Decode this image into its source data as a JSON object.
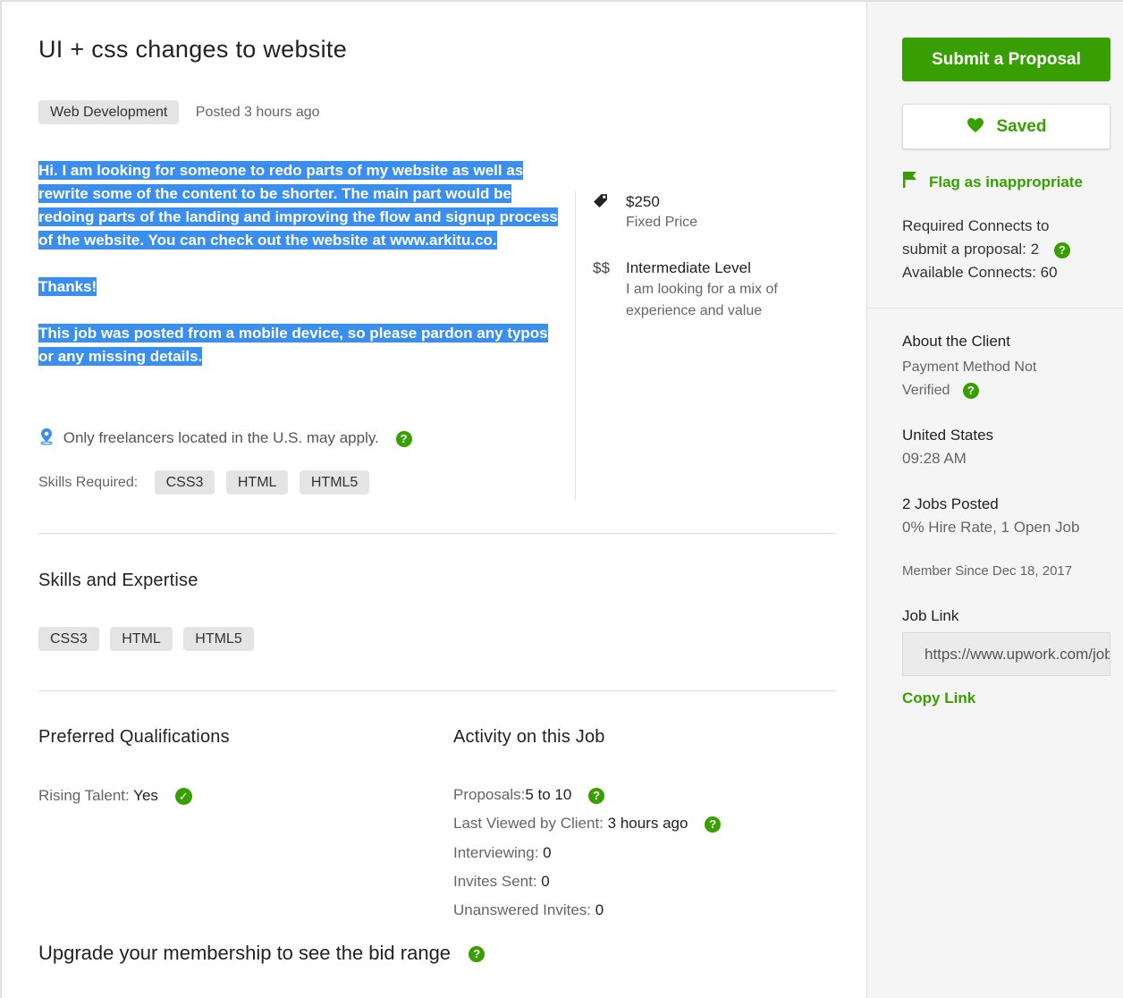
{
  "job": {
    "title": "UI + css changes to website",
    "category": "Web Development",
    "posted": "Posted 3 hours ago",
    "description": [
      "Hi. I am looking for someone to redo parts of my website as well as rewrite some of the content to be shorter. The main part would be redoing parts of the landing and improving the flow and signup process of the website. You can check out the website at www.arkitu.co.",
      "Thanks!",
      "This job was posted from a mobile device, so please pardon any typos or any missing details."
    ],
    "location_note": "Only freelancers located in the U.S. may apply.",
    "skills_required_label": "Skills Required:",
    "skills_required": [
      "CSS3",
      "HTML",
      "HTML5"
    ]
  },
  "price": {
    "amount": "$250",
    "type": "Fixed Price",
    "level_symbol": "$$",
    "level": "Intermediate Level",
    "level_desc": "I am looking for a mix of experience and value"
  },
  "skills_section": {
    "title": "Skills and Expertise",
    "skills": [
      "CSS3",
      "HTML",
      "HTML5"
    ]
  },
  "qualifications": {
    "title": "Preferred Qualifications",
    "rising_talent_label": "Rising Talent:",
    "rising_talent_value": "Yes"
  },
  "activity": {
    "title": "Activity on this Job",
    "proposals_label": "Proposals:",
    "proposals_value": "5 to 10",
    "last_viewed_label": "Last Viewed by Client:",
    "last_viewed_value": "3 hours ago",
    "interviewing_label": "Interviewing:",
    "interviewing_value": "0",
    "invites_label": "Invites Sent:",
    "invites_value": "0",
    "unanswered_label": "Unanswered Invites:",
    "unanswered_value": "0"
  },
  "upgrade": {
    "text": "Upgrade your membership to see the bid range"
  },
  "sidebar": {
    "submit_label": "Submit a Proposal",
    "saved_label": "Saved",
    "flag_label": "Flag as inappropriate",
    "connects_line1": "Required Connects to",
    "connects_line2": "submit a proposal: 2",
    "connects_line3": "Available Connects: 60",
    "client_title": "About the Client",
    "payment_line1": "Payment Method Not",
    "payment_line2": "Verified",
    "country": "United States",
    "time": "09:28 AM",
    "jobs_posted": "2 Jobs Posted",
    "hire_rate": "0% Hire Rate, 1 Open Job",
    "member_since": "Member Since Dec 18, 2017",
    "job_link_label": "Job Link",
    "job_link_value": "https://www.upwork.com/jobs/",
    "copy_link_label": "Copy Link"
  },
  "colors": {
    "accent": "#37a000",
    "selection": "#3a8ef0",
    "tag_bg": "#e4e4e4",
    "sidebar_bg": "#f5f5f5"
  },
  "icons": {
    "location": "map-pin-icon",
    "tag": "price-tag-icon",
    "help": "question-circle-icon",
    "check": "check-circle-icon",
    "heart": "heart-icon",
    "flag": "flag-icon"
  }
}
